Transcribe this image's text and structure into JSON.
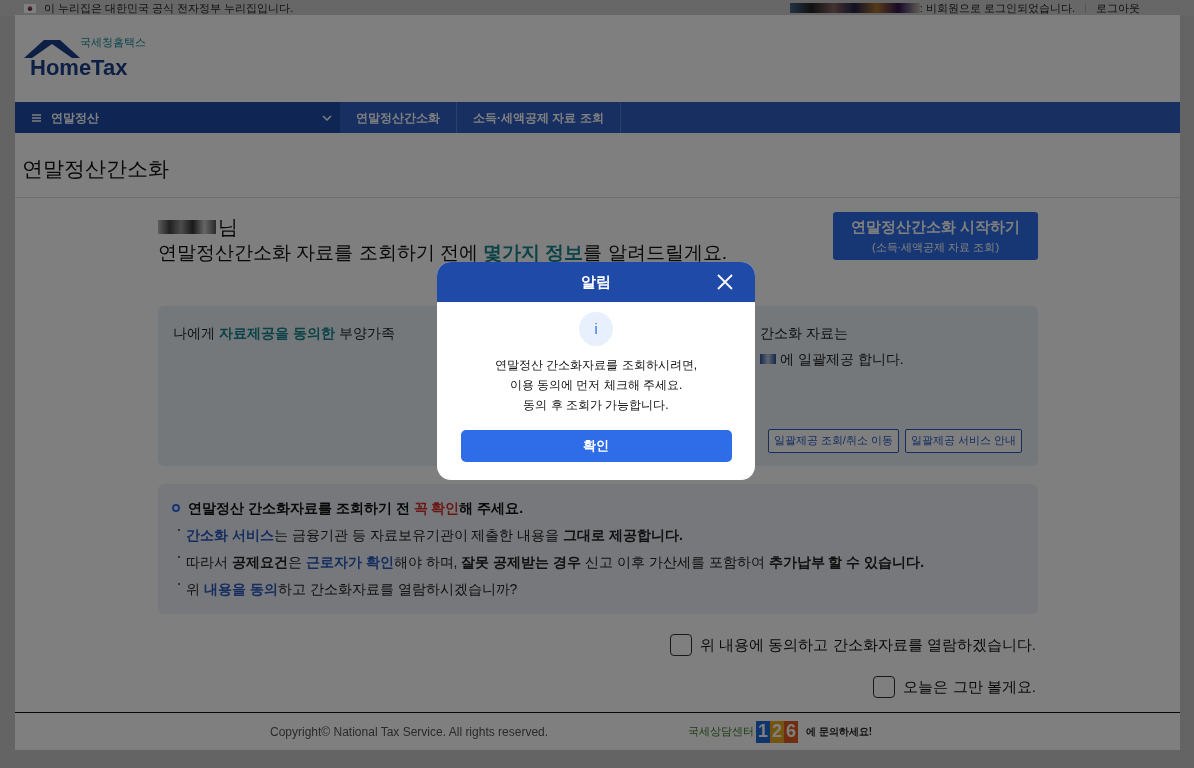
{
  "gov_banner": {
    "text": "이 누리집은 대한민국 공식 전자정부 누리집입니다."
  },
  "session": {
    "status": ": 비회원으로 로그인되었습니다.",
    "logout": "로그아웃"
  },
  "logo": {
    "subtitle": "국세청홈택스",
    "wordmark": "HomeTax"
  },
  "nav": {
    "menu": "연말정산",
    "breadcrumbs": [
      "연말정산간소화",
      "소득·세액공제 자료 조회"
    ]
  },
  "page_title": "연말정산간소화",
  "greeting": {
    "suffix": "님",
    "intro": [
      {
        "text": "연말정산간소화 자료를 조회하기 전에 ",
        "kind": "plain"
      },
      {
        "text": "몇가지 정보",
        "kind": "green"
      },
      {
        "text": "를 알려드릴게요.",
        "kind": "plain"
      }
    ]
  },
  "start_button": {
    "label": "연말정산간소화 시작하기",
    "sub": "(소득·세액공제 자료 조회)"
  },
  "dependents_panel": {
    "left": [
      {
        "text": "나에게 ",
        "kind": "plain"
      },
      {
        "text": "자료제공을 동의한",
        "kind": "green"
      },
      {
        "text": " 부양가족",
        "kind": "plain"
      }
    ],
    "right_line_1": "간소화 자료는",
    "right_line_2": "에 일괄제공 합니다.",
    "buttons": [
      "일괄제공 조회/취소 이동",
      "일괄제공 서비스 안내"
    ]
  },
  "notice": {
    "heading": [
      {
        "text": "연말정산 간소화자료를 조회하기 전 ",
        "kind": "bold"
      },
      {
        "text": "꼭 확인",
        "kind": "red"
      },
      {
        "text": "해 주세요.",
        "kind": "bold"
      }
    ],
    "bullets": [
      [
        {
          "text": "간소화 서비스",
          "kind": "blue"
        },
        {
          "text": "는 금융기관 등 자료보유기관이 제출한 내용을 ",
          "kind": "plain"
        },
        {
          "text": "그대로 제공합니다.",
          "kind": "bold"
        }
      ],
      [
        {
          "text": "따라서 ",
          "kind": "plain"
        },
        {
          "text": "공제요건",
          "kind": "bold"
        },
        {
          "text": "은 ",
          "kind": "plain"
        },
        {
          "text": "근로자가 확인",
          "kind": "blue"
        },
        {
          "text": "해야 하며, ",
          "kind": "plain"
        },
        {
          "text": "잘못 공제받는 경우",
          "kind": "bold"
        },
        {
          "text": " 신고 이후 가산세를 포함하여 ",
          "kind": "plain"
        },
        {
          "text": "추가납부 할 수 있습니다.",
          "kind": "bold"
        }
      ],
      [
        {
          "text": "위 ",
          "kind": "plain"
        },
        {
          "text": "내용을 동의",
          "kind": "blue"
        },
        {
          "text": "하고 간소화자료를 열람하시겠습니까?",
          "kind": "plain"
        }
      ]
    ]
  },
  "checkboxes": [
    {
      "label": "위 내용에 동의하고 간소화자료를 열람하겠습니다.",
      "checked": false
    },
    {
      "label": "오늘은 그만 볼게요.",
      "checked": false
    }
  ],
  "footer": {
    "copyright": "Copyright© National Tax Service. All rights reserved.",
    "center_name": "국세상담센터",
    "number": "126",
    "cta": "에 문의하세요!"
  },
  "dialog": {
    "title": "알림",
    "icon_glyph": "i",
    "lines": [
      "연말정산 간소화자료를 조회하시려면,",
      "이용 동의에 먼저 체크해 주세요.",
      "동의 후 조회가 가능합니다."
    ],
    "confirm": "확인"
  }
}
